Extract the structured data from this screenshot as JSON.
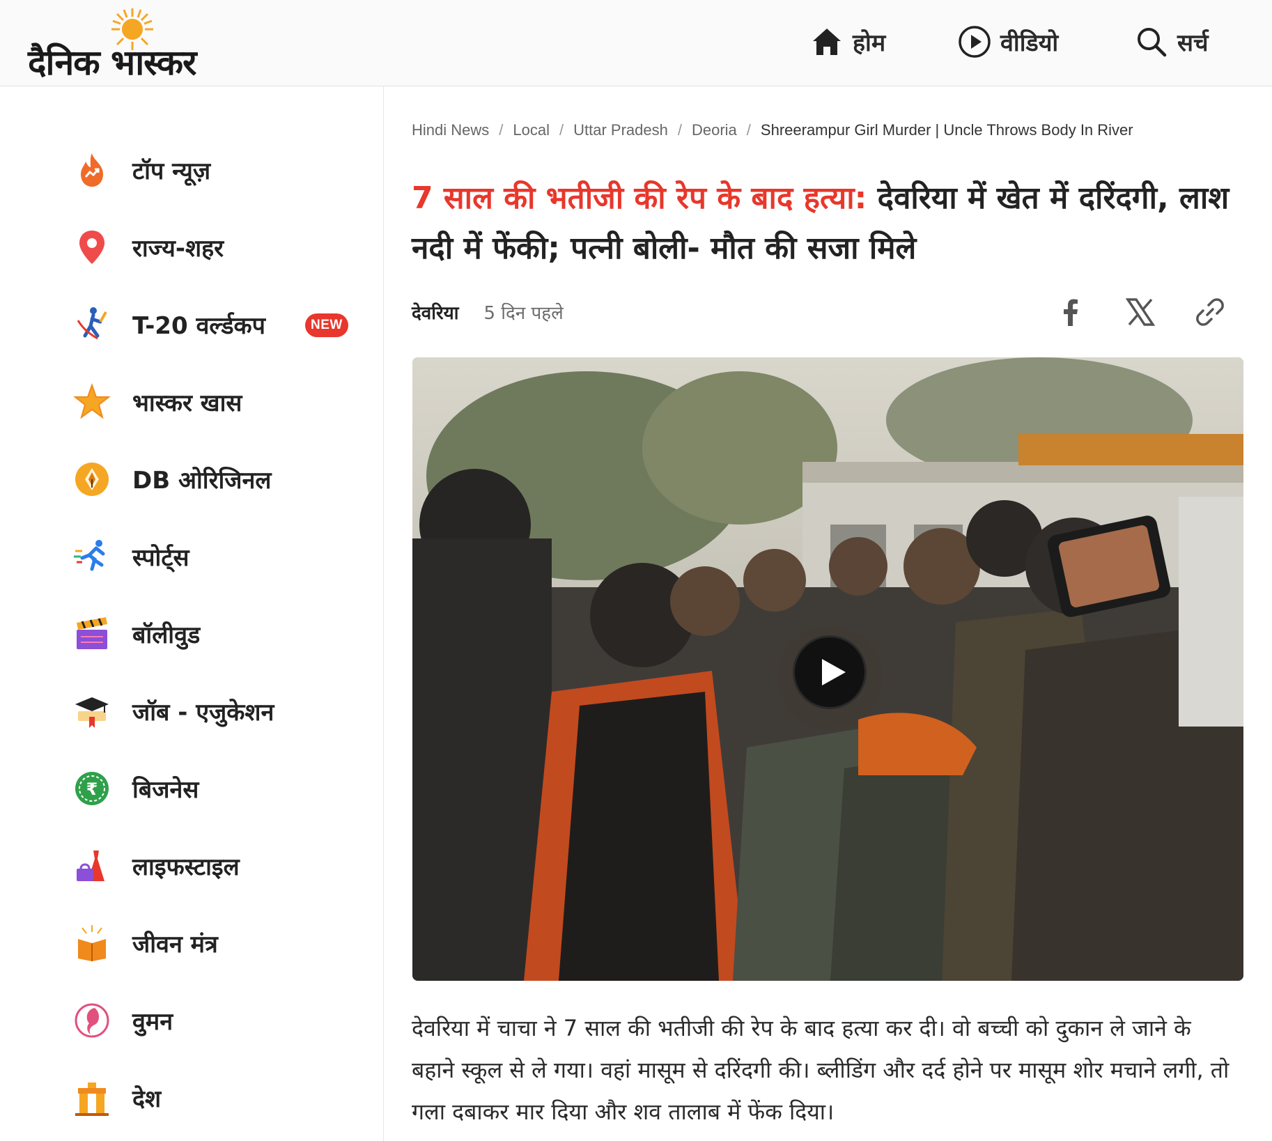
{
  "brand": {
    "logo_text": "दैनिक भास्कर"
  },
  "nav": {
    "home": "होम",
    "video": "वीडियो",
    "search": "सर्च"
  },
  "sidebar": {
    "items": [
      {
        "label": "टॉप न्यूज़",
        "icon": "flame-trend-icon"
      },
      {
        "label": "राज्य-शहर",
        "icon": "location-pin-icon"
      },
      {
        "label": "T-20 वर्ल्डकप",
        "icon": "cricket-batsman-icon",
        "badge": "NEW"
      },
      {
        "label": "भास्कर खास",
        "icon": "star-icon"
      },
      {
        "label": "DB ओरिजिनल",
        "icon": "pen-nib-icon"
      },
      {
        "label": "स्पोर्ट्स",
        "icon": "runner-icon"
      },
      {
        "label": "बॉलीवुड",
        "icon": "clapperboard-icon"
      },
      {
        "label": "जॉब - एजुकेशन",
        "icon": "graduation-cap-icon"
      },
      {
        "label": "बिजनेस",
        "icon": "rupee-icon"
      },
      {
        "label": "लाइफस्टाइल",
        "icon": "dress-bag-icon"
      },
      {
        "label": "जीवन मंत्र",
        "icon": "open-book-icon"
      },
      {
        "label": "वुमन",
        "icon": "woman-icon"
      },
      {
        "label": "देश",
        "icon": "india-gate-icon"
      }
    ]
  },
  "breadcrumb": [
    "Hindi News",
    "Local",
    "Uttar Pradesh",
    "Deoria",
    "Shreerampur Girl Murder | Uncle Throws Body In River"
  ],
  "article": {
    "headline_highlight": "7 साल की भतीजी की रेप के बाद हत्या:",
    "headline_rest": " देवरिया में खेत में दरिंदगी, लाश नदी में फेंकी; पत्नी बोली- मौत की सजा मिले",
    "location": "देवरिया",
    "time": "5 दिन पहले",
    "body": "देवरिया में चाचा ने 7 साल की भतीजी की रेप के बाद हत्या कर दी। वो बच्ची को दुकान ले जाने के बहाने स्कूल से ले गया। वहां मासूम से दरिंदगी की। ब्लीडिंग और दर्द होने पर मासूम शोर मचाने लगी, तो गला दबाकर मार दिया और शव तालाब में फेंक दिया।"
  },
  "colors": {
    "accent_red": "#e8372c",
    "logo_sun": "#f5a623"
  }
}
